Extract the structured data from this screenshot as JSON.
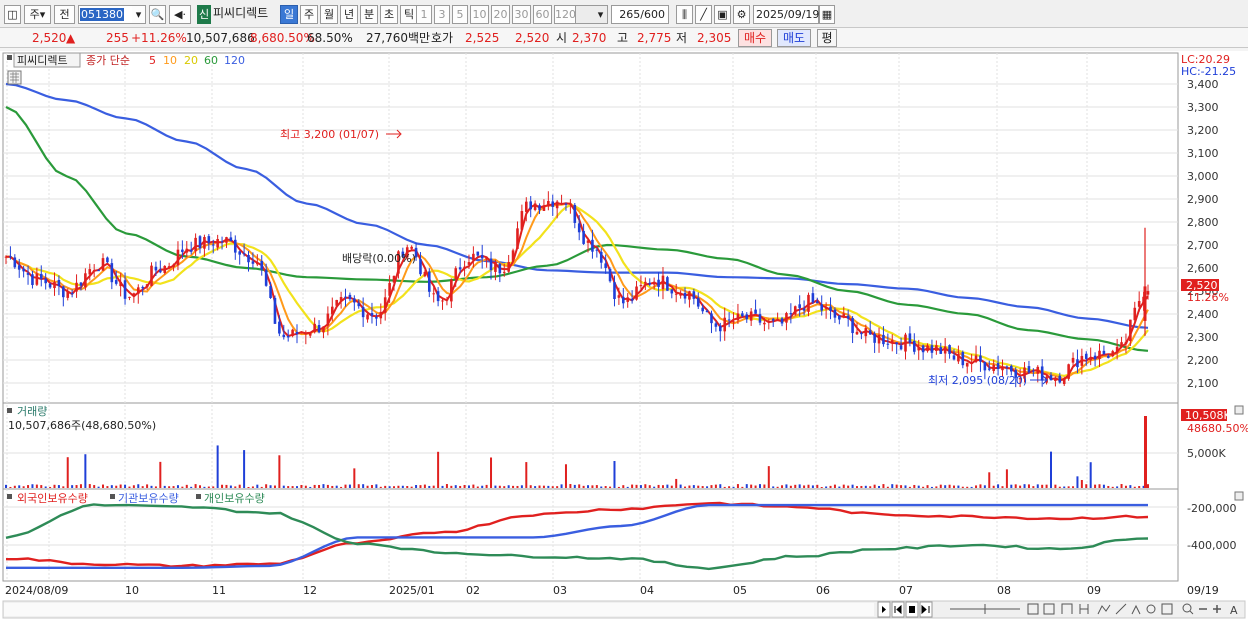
{
  "toolbar": {
    "period_label": "주",
    "prev_label": "전",
    "stock_code": "051380",
    "new_badge": "신",
    "stock_name": "피씨디렉트",
    "periods": [
      "일",
      "주",
      "월",
      "년",
      "분",
      "초",
      "틱"
    ],
    "active_period": "일",
    "intervals": [
      "1",
      "3",
      "5",
      "10",
      "20",
      "30",
      "60",
      "120"
    ],
    "count": "265",
    "count_total": "/600",
    "date": "2025/09/19"
  },
  "quote": {
    "price": "2,520",
    "change_arrow": "▲",
    "change": "255",
    "change_pct": "+11.26%",
    "volume": "10,507,686",
    "volume_ratio": "8,680.50%",
    "turnover": "68.50%",
    "trade_amount": "27,760백만",
    "ask_label": "호가",
    "ask1": "2,525",
    "ask2": "2,520",
    "open_label": "시",
    "open": "2,370",
    "high_label": "고",
    "high": "2,775",
    "low_label": "저",
    "low": "2,305",
    "buy_label": "매수",
    "sell_label": "매도",
    "avg_label": "평"
  },
  "price_panel": {
    "stock_name": "피씨디렉트",
    "ma_title": "종가 단순",
    "ma_periods": [
      {
        "label": "5",
        "color": "#e0201f"
      },
      {
        "label": "10",
        "color": "#ff9a1a"
      },
      {
        "label": "20",
        "color": "#f2e21c"
      },
      {
        "label": "60",
        "color": "#2a9a3a"
      },
      {
        "label": "120",
        "color": "#3a5ee0"
      }
    ],
    "lc_label": "LC:20.29",
    "hc_label": "HC:-21.25",
    "y_ticks": [
      "3,400",
      "3,300",
      "3,200",
      "3,100",
      "3,000",
      "2,900",
      "2,800",
      "2,700",
      "2,600",
      "2,500",
      "2,400",
      "2,300",
      "2,200",
      "2,100"
    ],
    "current_price_tag": "2,520",
    "current_pct_tag": "11.26%",
    "high_annotation": "최고 3,200 (01/07)",
    "low_annotation": "최저 2,095 (08/20)",
    "dividend_annotation": "배당락(0.00%)"
  },
  "volume_panel": {
    "title": "거래량",
    "summary": "10,507,686주(48,680.50%)",
    "y_tick": "5,000K",
    "value_tag": "10,508K",
    "pct_tag": "48680.50%"
  },
  "holding_panel": {
    "series": [
      {
        "label": "외국인보유수량",
        "color": "#e0201f"
      },
      {
        "label": "기관보유수량",
        "color": "#3a5ee0"
      },
      {
        "label": "개인보유수량",
        "color": "#2e8b57"
      }
    ],
    "y_ticks": [
      "-200,000",
      "-400,000"
    ]
  },
  "x_axis": {
    "labels": [
      "2024/08/09",
      "10",
      "11",
      "12",
      "2025/01",
      "02",
      "03",
      "04",
      "05",
      "06",
      "07",
      "08",
      "09"
    ],
    "end_label": "09/19"
  },
  "colors": {
    "up": "#e0201f",
    "down": "#1f3fd8",
    "grid": "#d9d9d9"
  },
  "chart_data": [
    {
      "type": "line",
      "title": "피씨디렉트 종가 단순",
      "x_labels": [
        "2024/08/09",
        "10",
        "11",
        "12",
        "2025/01",
        "02",
        "03",
        "04",
        "05",
        "06",
        "07",
        "08",
        "09"
      ],
      "ylim": [
        2050,
        3450
      ],
      "series": [
        {
          "name": "종가",
          "values": [
            2650,
            2550,
            2500,
            2620,
            2480,
            2600,
            2700,
            2720,
            2650,
            2300,
            2340,
            2450,
            2400,
            2700,
            2450,
            2650,
            2600,
            2880,
            2900,
            2700,
            2450,
            2550,
            2500,
            2350,
            2380,
            2350,
            2450,
            2380,
            2300,
            2280,
            2250,
            2200,
            2180,
            2150,
            2130,
            2220,
            2230,
            2520
          ]
        },
        {
          "name": "120",
          "values": [
            3400,
            3330,
            3250,
            3150,
            3030,
            2880,
            2790,
            2700,
            2630,
            2590,
            2580,
            2580,
            2560,
            2555,
            2530,
            2510,
            2470,
            2430,
            2380,
            2340
          ]
        },
        {
          "name": "60",
          "values": [
            3300,
            3000,
            2750,
            2650,
            2600,
            2560,
            2550,
            2540,
            2560,
            2610,
            2700,
            2680,
            2640,
            2570,
            2500,
            2440,
            2400,
            2330,
            2290,
            2240
          ]
        }
      ],
      "annotations": {
        "high": "최고 3,200 (01/07)",
        "low": "최저 2,095 (08/20)"
      }
    },
    {
      "type": "bar",
      "title": "거래량",
      "y_tick": "5,000K",
      "last_value_k": 10508
    },
    {
      "type": "line",
      "title": "보유수량",
      "y_ticks": [
        "-200,000",
        "-400,000"
      ],
      "series": [
        {
          "name": "외국인보유수량",
          "values": [
            -470000,
            -500000,
            -510000,
            -500000,
            -390000,
            -330000,
            -240000,
            -210000,
            -180000,
            -200000,
            -240000,
            -250000,
            -260000,
            -250000
          ]
        },
        {
          "name": "기관보유수량",
          "values": [
            -520000,
            -520000,
            -520000,
            -510000,
            -360000,
            -360000,
            -360000,
            -300000,
            -190000,
            -190000,
            -190000,
            -190000,
            -190000,
            -190000
          ]
        },
        {
          "name": "개인보유수량",
          "values": [
            -360000,
            -190000,
            -200000,
            -230000,
            -390000,
            -440000,
            -460000,
            -470000,
            -520000,
            -460000,
            -420000,
            -400000,
            -420000,
            -360000
          ]
        }
      ]
    }
  ]
}
